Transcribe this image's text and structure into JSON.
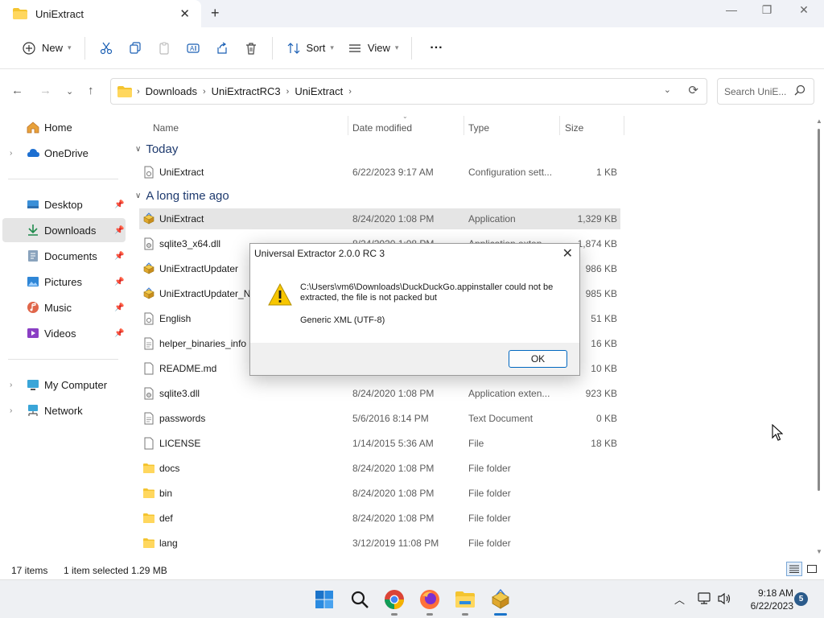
{
  "window": {
    "tab_title": "UniExtract",
    "tab_close": "✕",
    "new_tab": "+",
    "minimize": "—",
    "maximize": "❐",
    "close": "✕"
  },
  "toolbar": {
    "new_label": "New",
    "sort_label": "Sort",
    "view_label": "View",
    "more_label": "···"
  },
  "address": {
    "crumbs": [
      "Downloads",
      "UniExtractRC3",
      "UniExtract"
    ],
    "search_placeholder": "Search UniE..."
  },
  "sidebar": {
    "items": [
      {
        "label": "Home",
        "icon": "home-icon",
        "expandable": false,
        "pinned": false
      },
      {
        "label": "OneDrive",
        "icon": "cloud-icon",
        "expandable": true,
        "pinned": false
      },
      {
        "label": "Desktop",
        "icon": "desktop-icon",
        "expandable": false,
        "pinned": true
      },
      {
        "label": "Downloads",
        "icon": "download-icon",
        "expandable": false,
        "pinned": true,
        "selected": true
      },
      {
        "label": "Documents",
        "icon": "document-icon",
        "expandable": false,
        "pinned": true
      },
      {
        "label": "Pictures",
        "icon": "picture-icon",
        "expandable": false,
        "pinned": true
      },
      {
        "label": "Music",
        "icon": "music-icon",
        "expandable": false,
        "pinned": true
      },
      {
        "label": "Videos",
        "icon": "video-icon",
        "expandable": false,
        "pinned": true
      },
      {
        "label": "My Computer",
        "icon": "computer-icon",
        "expandable": true,
        "pinned": false
      },
      {
        "label": "Network",
        "icon": "network-icon",
        "expandable": true,
        "pinned": false
      }
    ]
  },
  "columns": {
    "name": "Name",
    "date": "Date modified",
    "type": "Type",
    "size": "Size"
  },
  "groups": {
    "today": "Today",
    "long_ago": "A long time ago"
  },
  "files": [
    {
      "name": "UniExtract",
      "date": "6/22/2023 9:17 AM",
      "type": "Configuration sett...",
      "size": "1 KB",
      "icon": "config-file-icon"
    },
    {
      "name": "UniExtract",
      "date": "8/24/2020 1:08 PM",
      "type": "Application",
      "size": "1,329 KB",
      "icon": "app-icon",
      "selected": true
    },
    {
      "name": "sqlite3_x64.dll",
      "date": "8/24/2020 1:08 PM",
      "type": "Application exten...",
      "size": "1,874 KB",
      "icon": "dll-icon"
    },
    {
      "name": "UniExtractUpdater",
      "date": "",
      "type": "",
      "size": "986 KB",
      "icon": "app-icon"
    },
    {
      "name": "UniExtractUpdater_No",
      "date": "",
      "type": "",
      "size": "985 KB",
      "icon": "app-icon"
    },
    {
      "name": "English",
      "date": "",
      "type": "",
      "size": "51 KB",
      "icon": "config-file-icon"
    },
    {
      "name": "helper_binaries_info",
      "date": "",
      "type": "",
      "size": "16 KB",
      "icon": "text-file-icon"
    },
    {
      "name": "README.md",
      "date": "",
      "type": "",
      "size": "10 KB",
      "icon": "file-icon"
    },
    {
      "name": "sqlite3.dll",
      "date": "8/24/2020 1:08 PM",
      "type": "Application exten...",
      "size": "923 KB",
      "icon": "dll-icon"
    },
    {
      "name": "passwords",
      "date": "5/6/2016 8:14 PM",
      "type": "Text Document",
      "size": "0 KB",
      "icon": "text-file-icon"
    },
    {
      "name": "LICENSE",
      "date": "1/14/2015 5:36 AM",
      "type": "File",
      "size": "18 KB",
      "icon": "file-icon"
    },
    {
      "name": "docs",
      "date": "8/24/2020 1:08 PM",
      "type": "File folder",
      "size": "",
      "icon": "folder-icon"
    },
    {
      "name": "bin",
      "date": "8/24/2020 1:08 PM",
      "type": "File folder",
      "size": "",
      "icon": "folder-icon"
    },
    {
      "name": "def",
      "date": "8/24/2020 1:08 PM",
      "type": "File folder",
      "size": "",
      "icon": "folder-icon"
    },
    {
      "name": "lang",
      "date": "3/12/2019 11:08 PM",
      "type": "File folder",
      "size": "",
      "icon": "folder-icon"
    }
  ],
  "status": {
    "count": "17 items",
    "selection": "1 item selected  1.29 MB"
  },
  "dialog": {
    "title": "Universal Extractor 2.0.0 RC 3",
    "close": "✕",
    "message": "C:\\Users\\vm6\\Downloads\\DuckDuckGo.appinstaller could not be extracted, the file is not packed but",
    "detail": "Generic XML (UTF-8)",
    "ok_label": "OK"
  },
  "taskbar": {
    "time": "9:18 AM",
    "date": "6/22/2023",
    "notifications": "5"
  },
  "colors": {
    "accent": "#0067c0",
    "folder": "#f4c430",
    "selection": "#e5e5e5"
  }
}
